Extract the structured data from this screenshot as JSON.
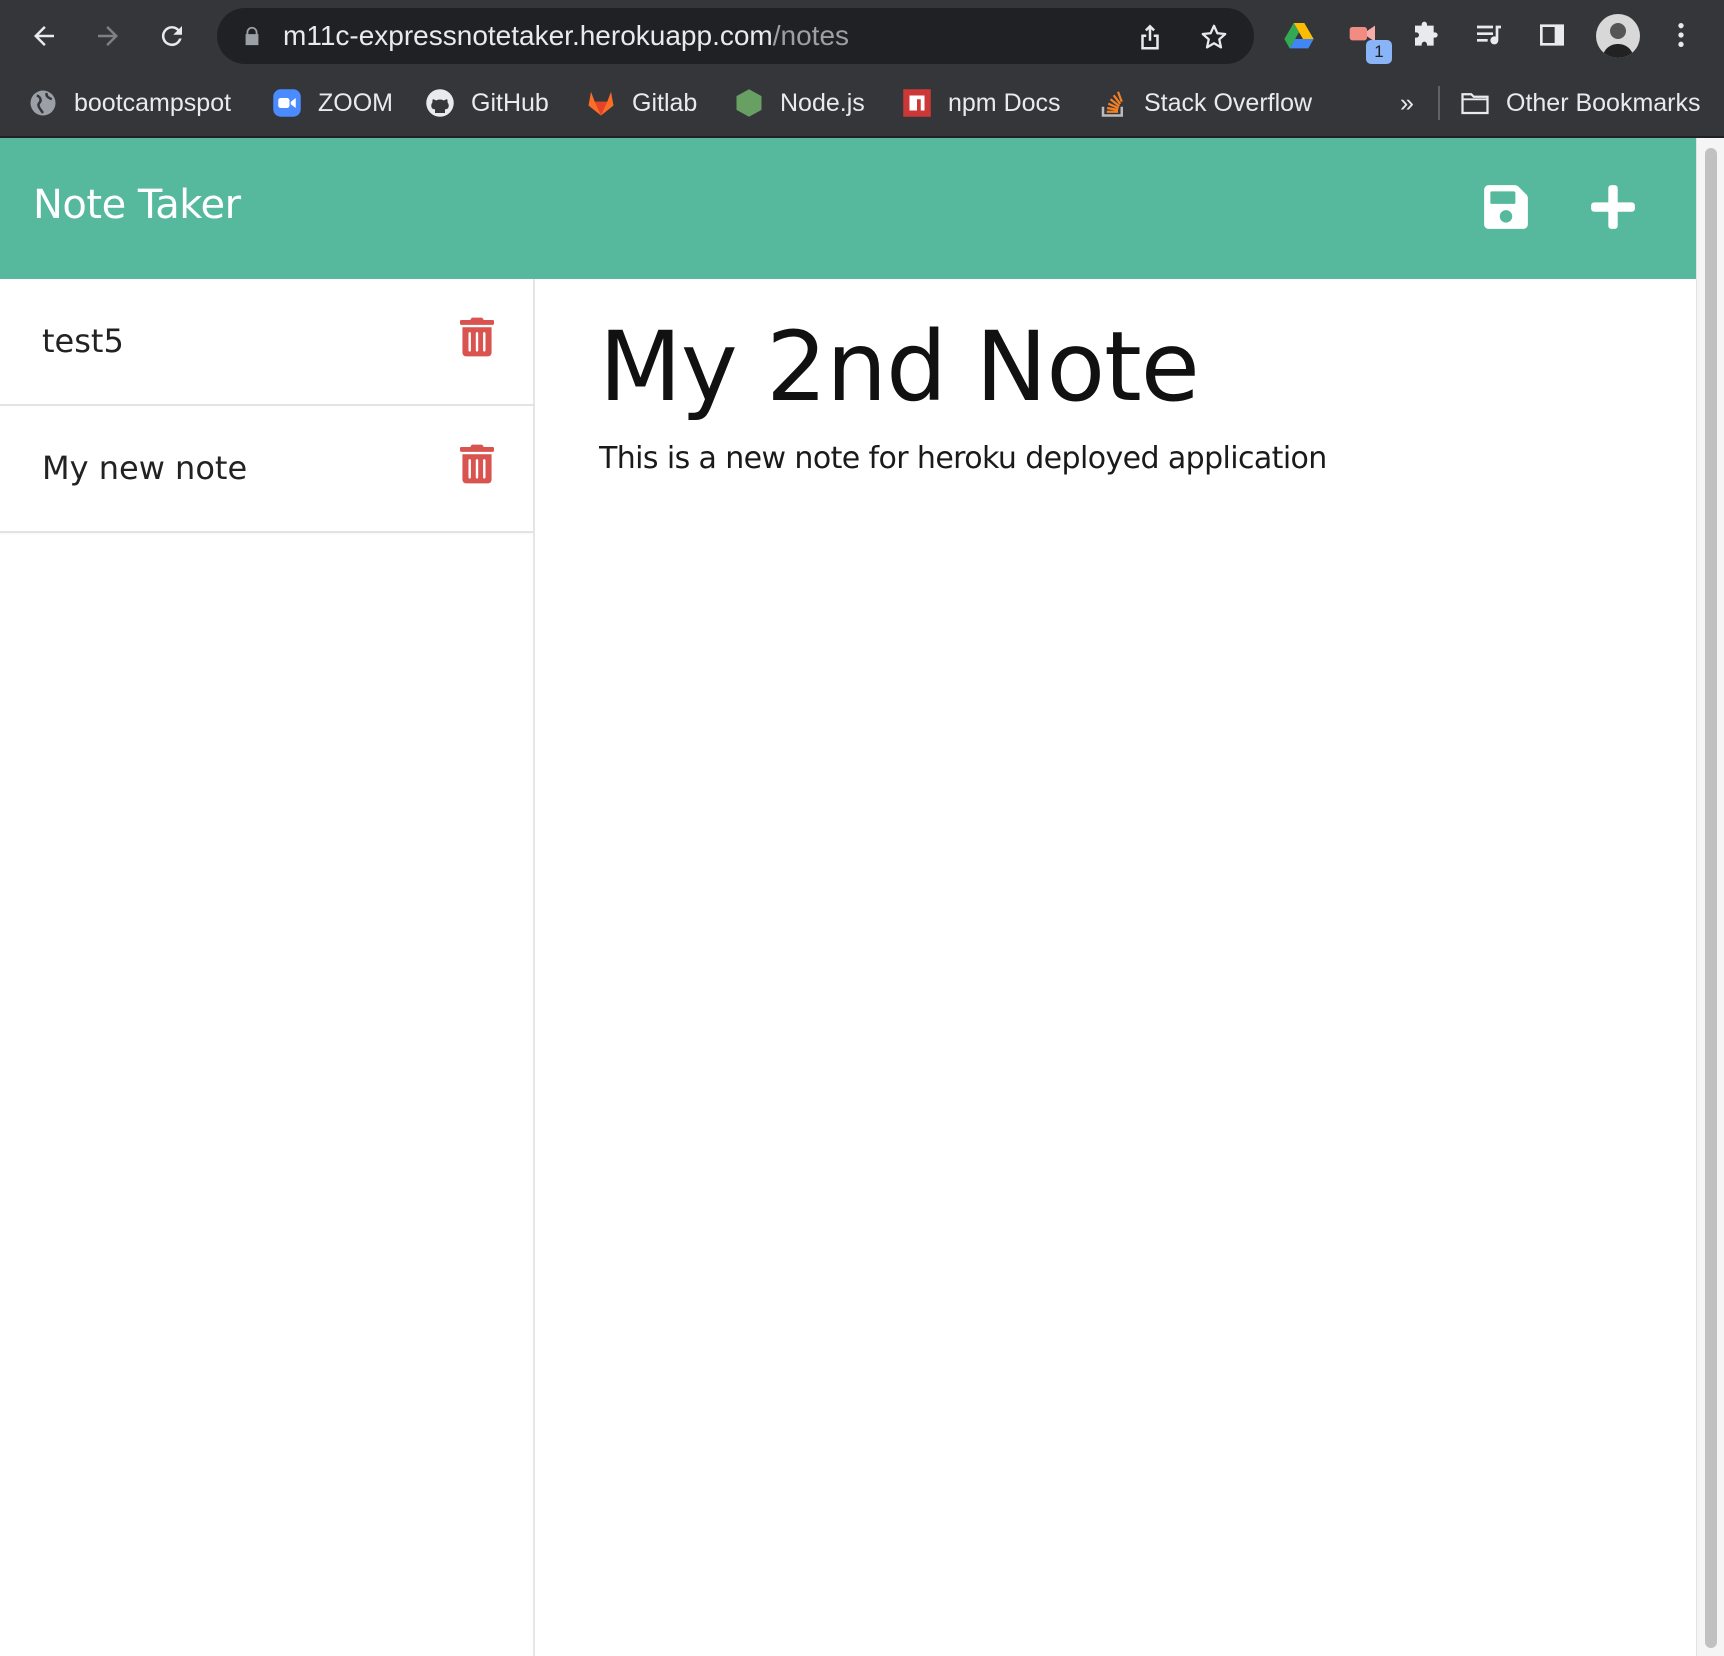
{
  "browser": {
    "url_host": "m11c-expressnotetaker.herokuapp.com",
    "url_path": "/notes",
    "extension_badge": "1",
    "bookmarks": [
      {
        "label": "bootcampspot",
        "icon": "globe-icon"
      },
      {
        "label": "ZOOM",
        "icon": "zoom-icon"
      },
      {
        "label": "GitHub",
        "icon": "github-icon"
      },
      {
        "label": "Gitlab",
        "icon": "gitlab-icon"
      },
      {
        "label": "Node.js",
        "icon": "nodejs-icon"
      },
      {
        "label": "npm Docs",
        "icon": "npm-icon"
      },
      {
        "label": "Stack Overflow",
        "icon": "stackoverflow-icon"
      }
    ],
    "overflow_label": "»",
    "other_bookmarks": "Other Bookmarks"
  },
  "app": {
    "brand": "Note Taker",
    "colors": {
      "navbar": "#56b99d",
      "delete": "#d9534f"
    },
    "notes": [
      {
        "title": "test5"
      },
      {
        "title": "My new note"
      }
    ],
    "active_note": {
      "title": "My 2nd Note",
      "text": "This is a new note for heroku deployed application"
    }
  }
}
